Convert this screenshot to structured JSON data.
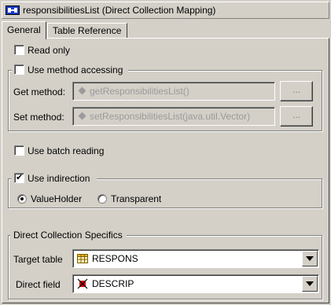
{
  "window": {
    "title": "responsibilitiesList (Direct Collection Mapping)",
    "icon": "mapping-icon"
  },
  "tabs": [
    {
      "label": "General",
      "active": true
    },
    {
      "label": "Table Reference",
      "active": false
    }
  ],
  "read_only": {
    "label": "Read only",
    "checked": false
  },
  "method_accessing": {
    "label": "Use method accessing",
    "checked": false,
    "get_label": "Get method:",
    "get_value": "getResponsibilitiesList()",
    "set_label": "Set method:",
    "set_value": "setResponsibilitiesList(java.util.Vector)",
    "browse_label": "..."
  },
  "batch_reading": {
    "label": "Use batch reading",
    "checked": false
  },
  "indirection": {
    "label": "Use indirection",
    "checked": true,
    "options": [
      {
        "label": "ValueHolder",
        "selected": true
      },
      {
        "label": "Transparent",
        "selected": false
      }
    ]
  },
  "specifics": {
    "legend": "Direct Collection Specifics",
    "target_table_label": "Target table",
    "target_table_value": "RESPONS",
    "target_table_icon": "table-icon",
    "direct_field_label": "Direct field",
    "direct_field_value": "DESCRIP",
    "direct_field_icon": "field-icon"
  },
  "colors": {
    "background": "#d4d0c8",
    "title_icon_blue": "#1c3ac8",
    "field_icon_red": "#d40000"
  }
}
